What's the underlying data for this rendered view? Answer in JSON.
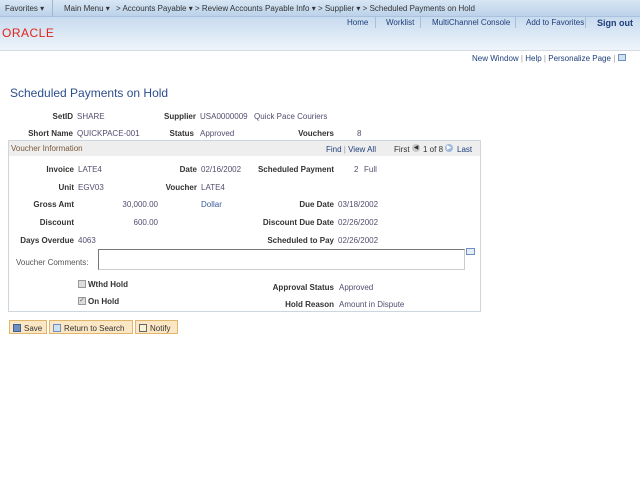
{
  "nav": {
    "favorites": "Favorites",
    "main_menu": "Main Menu",
    "crumbs": [
      "Accounts Payable",
      "Review Accounts Payable Info",
      "Supplier"
    ],
    "current": "Scheduled Payments on Hold"
  },
  "header": {
    "links": [
      "Home",
      "Worklist",
      "MultiChannel Console",
      "Add to Favorites"
    ],
    "sign_out": "Sign out",
    "logo": "ORACLE"
  },
  "page_links": {
    "new_window": "New Window",
    "help": "Help",
    "personalize": "Personalize Page"
  },
  "title": "Scheduled Payments on Hold",
  "summary": {
    "setid_label": "SetID",
    "setid": "SHARE",
    "supplier_label": "Supplier",
    "supplier_id": "USA0000009",
    "supplier_name": "Quick Pace Couriers",
    "short_name_label": "Short Name",
    "short_name": "QUICKPACE-001",
    "status_label": "Status",
    "status": "Approved",
    "vouchers_label": "Vouchers",
    "vouchers": "8"
  },
  "voucher": {
    "header": "Voucher Information",
    "find": "Find",
    "view_all": "View All",
    "first": "First",
    "count": "1 of 8",
    "last": "Last",
    "invoice_label": "Invoice",
    "invoice": "LATE4",
    "date_label": "Date",
    "date": "02/16/2002",
    "sched_payment_label": "Scheduled Payment",
    "sched_payment": "2",
    "sched_payment_type": "Full",
    "unit_label": "Unit",
    "unit": "EGV03",
    "voucher_label": "Voucher",
    "voucher": "LATE4",
    "gross_label": "Gross Amt",
    "gross": "30,000.00",
    "currency": "Dollar",
    "due_label": "Due Date",
    "due": "03/18/2002",
    "discount_label": "Discount",
    "discount": "600.00",
    "disc_due_label": "Discount Due Date",
    "disc_due": "02/26/2002",
    "overdue_label": "Days Overdue",
    "overdue": "4063",
    "sched_pay_label": "Scheduled to Pay",
    "sched_pay": "02/26/2002",
    "comments_label": "Voucher Comments:",
    "comments": "",
    "withd_hold_label": "Wthd Hold",
    "withd_hold": false,
    "on_hold_label": "On Hold",
    "on_hold": true,
    "approval_label": "Approval Status",
    "approval": "Approved",
    "hold_reason_label": "Hold Reason",
    "hold_reason": "Amount in Dispute"
  },
  "buttons": {
    "save": "Save",
    "return": "Return to Search",
    "notify": "Notify"
  },
  "colors": {
    "brand": "#e2231a",
    "link": "#1f3f7a",
    "title": "#2d4e8e"
  }
}
